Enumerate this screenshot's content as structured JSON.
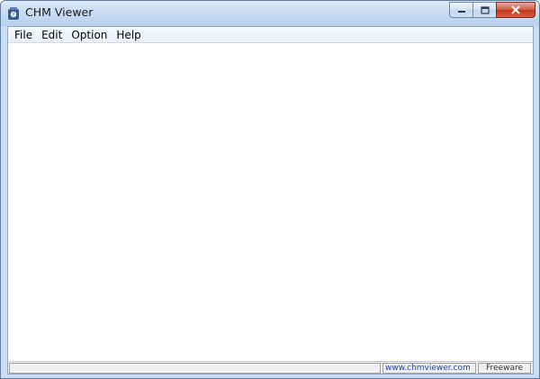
{
  "window": {
    "title": "CHM Viewer"
  },
  "menubar": {
    "items": [
      {
        "label": "File",
        "name": "menu-file"
      },
      {
        "label": "Edit",
        "name": "menu-edit"
      },
      {
        "label": "Option",
        "name": "menu-option"
      },
      {
        "label": "Help",
        "name": "menu-help"
      }
    ]
  },
  "statusbar": {
    "main": "",
    "url": "www.chmviewer.com",
    "license": "Freeware"
  },
  "colors": {
    "titlebar": "#c7dbf2",
    "close_button": "#c2381e",
    "link": "#1a3fb4"
  }
}
